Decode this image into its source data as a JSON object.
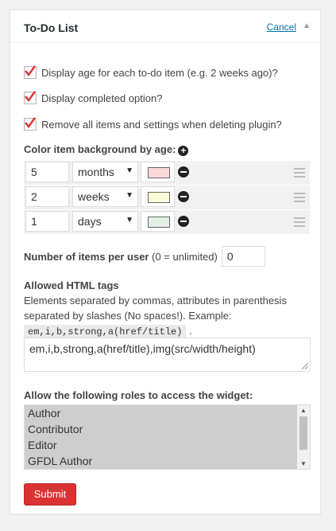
{
  "widget": {
    "title": "To-Do List",
    "cancel_label": "Cancel",
    "collapse_glyph": "▲"
  },
  "options": [
    {
      "label": "Display age for each to-do item (e.g. 2 weeks ago)?",
      "checked": true
    },
    {
      "label": "Display completed option?",
      "checked": true
    },
    {
      "label": "Remove all items and settings when deleting plugin?",
      "checked": true
    }
  ],
  "age_colors": {
    "label": "Color item background by age:",
    "rows": [
      {
        "value": "5",
        "unit": "months",
        "color": "#fcd9d9"
      },
      {
        "value": "2",
        "unit": "weeks",
        "color": "#fdfcd9"
      },
      {
        "value": "1",
        "unit": "days",
        "color": "#e2f1e4"
      }
    ]
  },
  "items_per_user": {
    "label": "Number of items per user",
    "hint": " (0 = unlimited)",
    "value": "0"
  },
  "html_tags": {
    "label": "Allowed HTML tags",
    "description": "Elements separated by commas, attributes in parenthesis separated by slashes (No spaces!). Example:",
    "example": "em,i,b,strong,a(href/title)",
    "example_suffix": ".",
    "value": "em,i,b,strong,a(href/title),img(src/width/height)"
  },
  "roles": {
    "label": "Allow the following roles to access the widget:",
    "options": [
      "Author",
      "Contributor",
      "Editor",
      "GFDL Author"
    ]
  },
  "submit_label": "Submit",
  "colors": {
    "accent_red": "#dc3232",
    "link_blue": "#0073aa"
  }
}
